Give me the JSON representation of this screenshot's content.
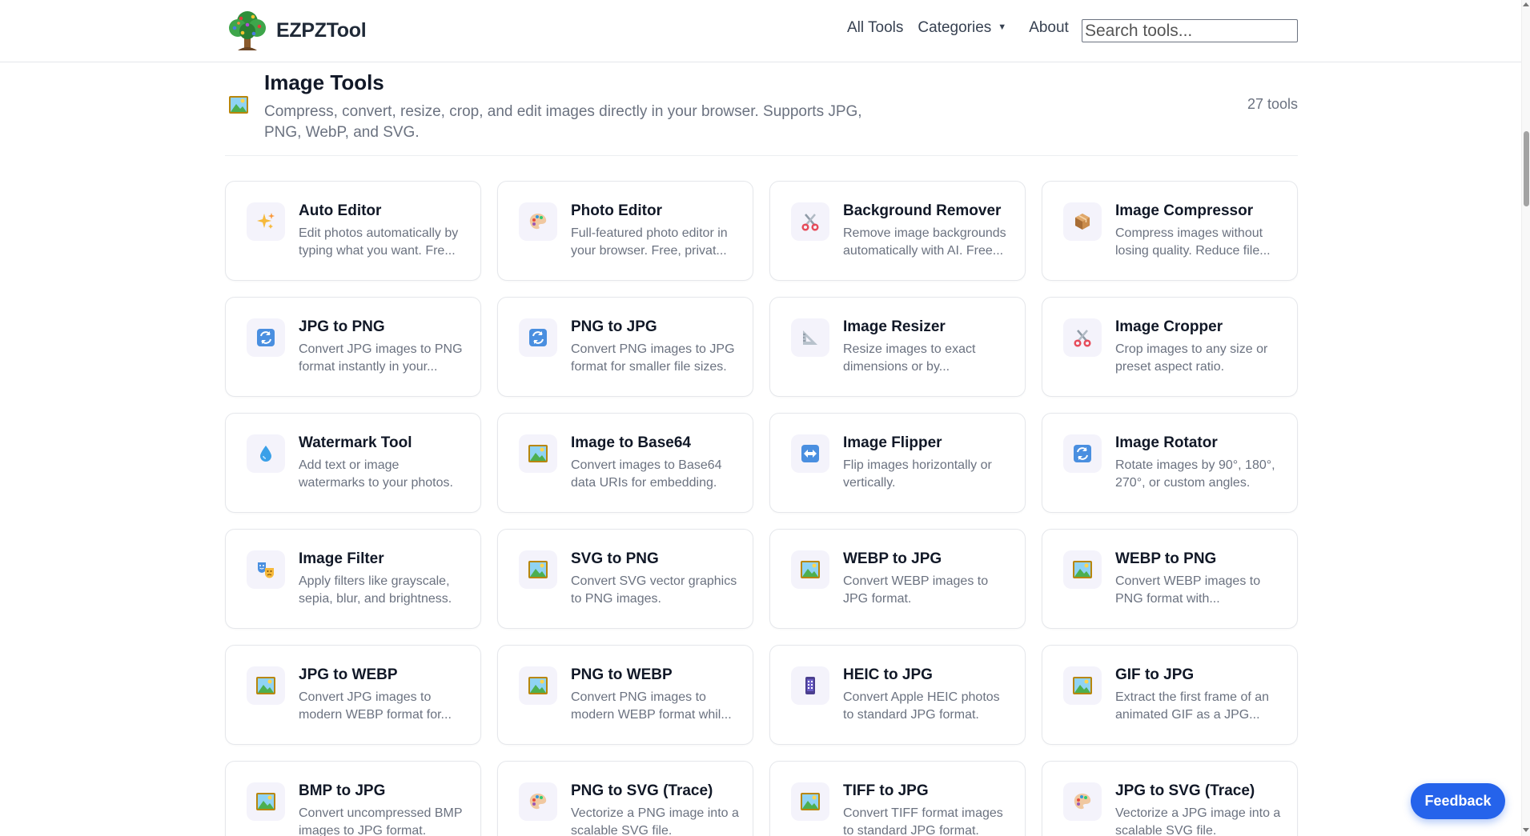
{
  "brand": {
    "name": "EZPZTool"
  },
  "nav": {
    "all_tools": "All Tools",
    "categories": "Categories",
    "about": "About"
  },
  "search": {
    "placeholder": "Search tools..."
  },
  "section": {
    "icon": "picture-icon",
    "title": "Image Tools",
    "description": "Compress, convert, resize, crop, and edit images directly in your browser. Supports JPG, PNG, WebP, and SVG.",
    "count": "27 tools"
  },
  "tools": [
    {
      "title": "Auto Editor",
      "desc": "Edit photos automatically by typing what you want. Fre...",
      "icon": "sparkles-icon"
    },
    {
      "title": "Photo Editor",
      "desc": "Full-featured photo editor in your browser. Free, privat...",
      "icon": "palette-icon"
    },
    {
      "title": "Background Remover",
      "desc": "Remove image backgrounds automatically with AI. Free...",
      "icon": "scissors-icon"
    },
    {
      "title": "Image Compressor",
      "desc": "Compress images without losing quality. Reduce file...",
      "icon": "package-icon"
    },
    {
      "title": "JPG to PNG",
      "desc": "Convert JPG images to PNG format instantly in your...",
      "icon": "convert-icon"
    },
    {
      "title": "PNG to JPG",
      "desc": "Convert PNG images to JPG format for smaller file sizes.",
      "icon": "convert-icon"
    },
    {
      "title": "Image Resizer",
      "desc": "Resize images to exact dimensions or by...",
      "icon": "ruler-triangle-icon"
    },
    {
      "title": "Image Cropper",
      "desc": "Crop images to any size or preset aspect ratio.",
      "icon": "scissors-icon"
    },
    {
      "title": "Watermark Tool",
      "desc": "Add text or image watermarks to your photos.",
      "icon": "droplet-icon"
    },
    {
      "title": "Image to Base64",
      "desc": "Convert images to Base64 data URIs for embedding.",
      "icon": "picture-icon"
    },
    {
      "title": "Image Flipper",
      "desc": "Flip images horizontally or vertically.",
      "icon": "flip-arrows-icon"
    },
    {
      "title": "Image Rotator",
      "desc": "Rotate images by 90°, 180°, 270°, or custom angles.",
      "icon": "convert-icon"
    },
    {
      "title": "Image Filter",
      "desc": "Apply filters like grayscale, sepia, blur, and brightness.",
      "icon": "theater-masks-icon"
    },
    {
      "title": "SVG to PNG",
      "desc": "Convert SVG vector graphics to PNG images.",
      "icon": "picture-icon"
    },
    {
      "title": "WEBP to JPG",
      "desc": "Convert WEBP images to JPG format.",
      "icon": "picture-icon"
    },
    {
      "title": "WEBP to PNG",
      "desc": "Convert WEBP images to PNG format with...",
      "icon": "picture-icon"
    },
    {
      "title": "JPG to WEBP",
      "desc": "Convert JPG images to modern WEBP format for...",
      "icon": "picture-icon"
    },
    {
      "title": "PNG to WEBP",
      "desc": "Convert PNG images to modern WEBP format whil...",
      "icon": "picture-icon"
    },
    {
      "title": "HEIC to JPG",
      "desc": "Convert Apple HEIC photos to standard JPG format.",
      "icon": "phone-icon"
    },
    {
      "title": "GIF to JPG",
      "desc": "Extract the first frame of an animated GIF as a JPG...",
      "icon": "picture-icon"
    },
    {
      "title": "BMP to JPG",
      "desc": "Convert uncompressed BMP images to JPG format.",
      "icon": "picture-icon"
    },
    {
      "title": "PNG to SVG (Trace)",
      "desc": "Vectorize a PNG image into a scalable SVG file.",
      "icon": "palette-icon"
    },
    {
      "title": "TIFF to JPG",
      "desc": "Convert TIFF format images to standard JPG format.",
      "icon": "picture-icon"
    },
    {
      "title": "JPG to SVG (Trace)",
      "desc": "Vectorize a JPG image into a scalable SVG file.",
      "icon": "palette-icon"
    }
  ],
  "feedback": {
    "label": "Feedback"
  },
  "colors": {
    "accent": "#2563eb",
    "border": "#e5e7eb",
    "icon_bg": "#f4f3fb"
  }
}
